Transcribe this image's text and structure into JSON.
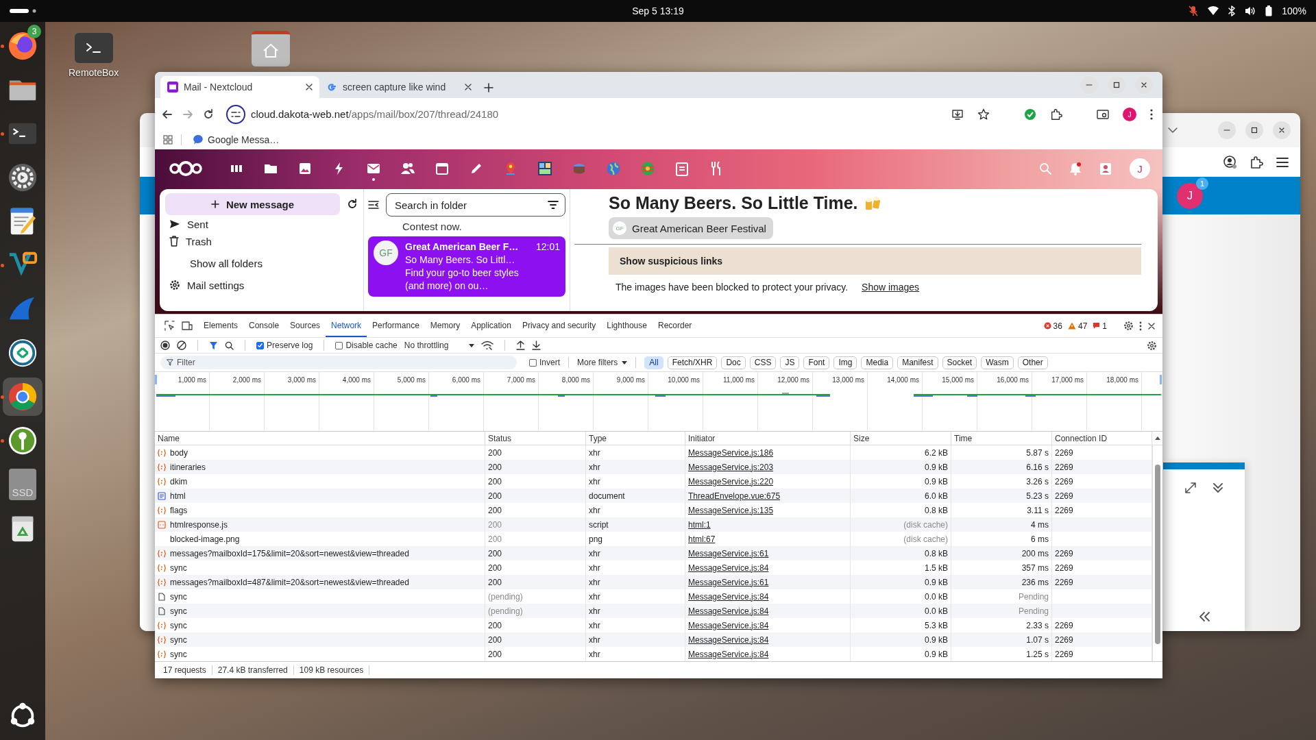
{
  "top_bar": {
    "clock": "Sep 5  13:19",
    "battery": "100%"
  },
  "dock": {
    "items": [
      {
        "kind": "firefox",
        "running": true,
        "selected": false,
        "badge": "3"
      },
      {
        "kind": "files",
        "running": false,
        "selected": false
      },
      {
        "kind": "terminal",
        "running": true,
        "selected": false
      },
      {
        "kind": "settings",
        "running": false,
        "selected": false
      },
      {
        "kind": "editor",
        "running": false,
        "selected": false
      },
      {
        "kind": "code",
        "running": true,
        "selected": false
      },
      {
        "kind": "fin",
        "running": false,
        "selected": false
      },
      {
        "kind": "remote",
        "running": false,
        "selected": false
      },
      {
        "kind": "chrome",
        "running": true,
        "selected": true
      },
      {
        "kind": "key",
        "running": true,
        "selected": false
      },
      {
        "kind": "drive",
        "running": false,
        "selected": false,
        "label": "SSD"
      },
      {
        "kind": "trash",
        "running": false,
        "selected": false
      }
    ]
  },
  "desktop": {
    "icons": [
      {
        "kind": "terminal",
        "label": "RemoteBox"
      },
      {
        "kind": "home"
      }
    ]
  },
  "back_window": {
    "avatar": "J",
    "badge": "1"
  },
  "browser": {
    "tabs": [
      {
        "kind": "mail",
        "title": "Mail - Nextcloud",
        "selected": true
      },
      {
        "kind": "google",
        "title": "screen capture like wind",
        "selected": false
      }
    ],
    "address": {
      "host": "cloud.dakota-web.net",
      "path": "/apps/mail/box/207/thread/24180"
    },
    "profile": "J",
    "bookmarks": [
      {
        "label": "Google Messa…"
      }
    ]
  },
  "mail": {
    "apps": [
      {
        "kind": "dashboard",
        "selected": false
      },
      {
        "kind": "files",
        "selected": false
      },
      {
        "kind": "photos",
        "selected": false
      },
      {
        "kind": "activity",
        "selected": false
      },
      {
        "kind": "mail",
        "selected": true
      },
      {
        "kind": "contacts",
        "selected": false
      },
      {
        "kind": "calendar",
        "selected": false
      },
      {
        "kind": "notes",
        "selected": false
      },
      {
        "kind": "maps",
        "selected": false
      },
      {
        "kind": "tile",
        "selected": false
      },
      {
        "kind": "cake",
        "selected": false
      },
      {
        "kind": "globe",
        "selected": false
      },
      {
        "kind": "world",
        "selected": false
      },
      {
        "kind": "clipboard",
        "selected": false
      },
      {
        "kind": "cookbook",
        "selected": false
      }
    ],
    "avatar": "J",
    "compose": "New message",
    "folders": [
      {
        "kind": "sent",
        "label": "Sent"
      },
      {
        "kind": "trash",
        "label": "Trash"
      },
      {
        "kind": "more",
        "label": "Show all folders"
      },
      {
        "kind": "settings",
        "label": "Mail settings"
      }
    ],
    "search": {
      "placeholder": "Search in folder"
    },
    "list": {
      "snippet": "Contest now.",
      "messages": [
        {
          "avatar": "GF",
          "sender": "Great American Beer F…",
          "time": "12:01",
          "subject": "So Many Beers. So Littl…",
          "preview": "Find your go-to beer styles (and more) on ou…",
          "selected": true
        }
      ]
    },
    "thread": {
      "title": "So Many Beers. So Little Time.",
      "sender": {
        "avatar": "GF",
        "name": "Great American Beer Festival"
      },
      "warning": "Show suspicious links",
      "notice": "The images have been blocked to protect your privacy.",
      "show_images": "Show images"
    }
  },
  "devtools": {
    "tabs": [
      {
        "label": "Elements",
        "selected": false
      },
      {
        "label": "Console",
        "selected": false
      },
      {
        "label": "Sources",
        "selected": false
      },
      {
        "label": "Network",
        "selected": true
      },
      {
        "label": "Performance",
        "selected": false
      },
      {
        "label": "Memory",
        "selected": false
      },
      {
        "label": "Application",
        "selected": false
      },
      {
        "label": "Privacy and security",
        "selected": false
      },
      {
        "label": "Lighthouse",
        "selected": false
      },
      {
        "label": "Recorder",
        "selected": false
      }
    ],
    "errors": "36",
    "warnings": "47",
    "issues": "1",
    "preserve_log": {
      "label": "Preserve log",
      "checked": true
    },
    "disable_cache": {
      "label": "Disable cache",
      "checked": false
    },
    "throttling": "No throttling",
    "filter": {
      "placeholder": "Filter"
    },
    "invert": {
      "label": "Invert",
      "checked": false
    },
    "more_filters": "More filters",
    "type_filters": [
      {
        "label": "All",
        "selected": true
      },
      {
        "label": "Fetch/XHR",
        "selected": false
      },
      {
        "label": "Doc",
        "selected": false
      },
      {
        "label": "CSS",
        "selected": false
      },
      {
        "label": "JS",
        "selected": false
      },
      {
        "label": "Font",
        "selected": false
      },
      {
        "label": "Img",
        "selected": false
      },
      {
        "label": "Media",
        "selected": false
      },
      {
        "label": "Manifest",
        "selected": false
      },
      {
        "label": "Socket",
        "selected": false
      },
      {
        "label": "Wasm",
        "selected": false
      },
      {
        "label": "Other",
        "selected": false
      }
    ],
    "timeline": {
      "ticks": [
        "1,000 ms",
        "2,000 ms",
        "3,000 ms",
        "4,000 ms",
        "5,000 ms",
        "6,000 ms",
        "7,000 ms",
        "8,000 ms",
        "9,000 ms",
        "10,000 ms",
        "11,000 ms",
        "12,000 ms",
        "13,000 ms",
        "14,000 ms",
        "15,000 ms",
        "16,000 ms",
        "17,000 ms",
        "18,000 ms"
      ]
    },
    "table": {
      "columns": [
        "Name",
        "Status",
        "Type",
        "Initiator",
        "Size",
        "Time",
        "Connection ID"
      ],
      "rows": [
        {
          "kind": "xhr",
          "name": "body",
          "status": "200",
          "type": "xhr",
          "initiator": "MessageService.js:186",
          "size": "6.2 kB",
          "time": "5.87 s",
          "connection": "2269",
          "status_muted": false,
          "size_muted": false,
          "time_muted": false
        },
        {
          "kind": "xhr",
          "name": "itineraries",
          "status": "200",
          "type": "xhr",
          "initiator": "MessageService.js:203",
          "size": "0.9 kB",
          "time": "6.16 s",
          "connection": "2269",
          "status_muted": false,
          "size_muted": false,
          "time_muted": false
        },
        {
          "kind": "xhr",
          "name": "dkim",
          "status": "200",
          "type": "xhr",
          "initiator": "MessageService.js:220",
          "size": "0.9 kB",
          "time": "3.26 s",
          "connection": "2269",
          "status_muted": false,
          "size_muted": false,
          "time_muted": false
        },
        {
          "kind": "document",
          "name": "html",
          "status": "200",
          "type": "document",
          "initiator": "ThreadEnvelope.vue:675",
          "size": "6.0 kB",
          "time": "5.23 s",
          "connection": "2269",
          "status_muted": false,
          "size_muted": false,
          "time_muted": false
        },
        {
          "kind": "xhr",
          "name": "flags",
          "status": "200",
          "type": "xhr",
          "initiator": "MessageService.js:135",
          "size": "0.8 kB",
          "time": "3.11 s",
          "connection": "2269",
          "status_muted": false,
          "size_muted": false,
          "time_muted": false
        },
        {
          "kind": "script",
          "name": "htmlresponse.js",
          "status": "200",
          "type": "script",
          "initiator": "html:1",
          "size": "(disk cache)",
          "time": "4 ms",
          "status_muted": true,
          "size_muted": true,
          "time_muted": false
        },
        {
          "kind": "image",
          "name": "blocked-image.png",
          "status": "200",
          "type": "png",
          "initiator": "html:67",
          "size": "(disk cache)",
          "time": "6 ms",
          "status_muted": true,
          "size_muted": true,
          "time_muted": false
        },
        {
          "kind": "xhr",
          "name": "messages?mailboxId=175&limit=20&sort=newest&view=threaded",
          "status": "200",
          "type": "xhr",
          "initiator": "MessageService.js:61",
          "size": "0.8 kB",
          "time": "200 ms",
          "connection": "2269",
          "status_muted": false,
          "size_muted": false,
          "time_muted": false
        },
        {
          "kind": "xhr",
          "name": "sync",
          "status": "200",
          "type": "xhr",
          "initiator": "MessageService.js:84",
          "size": "1.5 kB",
          "time": "357 ms",
          "connection": "2269",
          "status_muted": false,
          "size_muted": false,
          "time_muted": false
        },
        {
          "kind": "xhr",
          "name": "messages?mailboxId=487&limit=20&sort=newest&view=threaded",
          "status": "200",
          "type": "xhr",
          "initiator": "MessageService.js:61",
          "size": "0.9 kB",
          "time": "236 ms",
          "connection": "2269",
          "status_muted": false,
          "size_muted": false,
          "time_muted": false
        },
        {
          "kind": "pending",
          "name": "sync",
          "status": "(pending)",
          "type": "xhr",
          "initiator": "MessageService.js:84",
          "size": "0.0 kB",
          "time": "Pending",
          "status_muted": true,
          "size_muted": false,
          "time_muted": true
        },
        {
          "kind": "pending",
          "name": "sync",
          "status": "(pending)",
          "type": "xhr",
          "initiator": "MessageService.js:84",
          "size": "0.0 kB",
          "time": "Pending",
          "status_muted": true,
          "size_muted": false,
          "time_muted": true
        },
        {
          "kind": "xhr",
          "name": "sync",
          "status": "200",
          "type": "xhr",
          "initiator": "MessageService.js:84",
          "size": "5.3 kB",
          "time": "2.33 s",
          "connection": "2269",
          "status_muted": false,
          "size_muted": false,
          "time_muted": false
        },
        {
          "kind": "xhr",
          "name": "sync",
          "status": "200",
          "type": "xhr",
          "initiator": "MessageService.js:84",
          "size": "0.9 kB",
          "time": "1.07 s",
          "connection": "2269",
          "status_muted": false,
          "size_muted": false,
          "time_muted": false
        },
        {
          "kind": "xhr",
          "name": "sync",
          "status": "200",
          "type": "xhr",
          "initiator": "MessageService.js:84",
          "size": "0.9 kB",
          "time": "1.25 s",
          "connection": "2269",
          "status_muted": false,
          "size_muted": false,
          "time_muted": false
        }
      ]
    },
    "status": [
      "17 requests",
      "27.4 kB transferred",
      "109 kB resources"
    ]
  }
}
